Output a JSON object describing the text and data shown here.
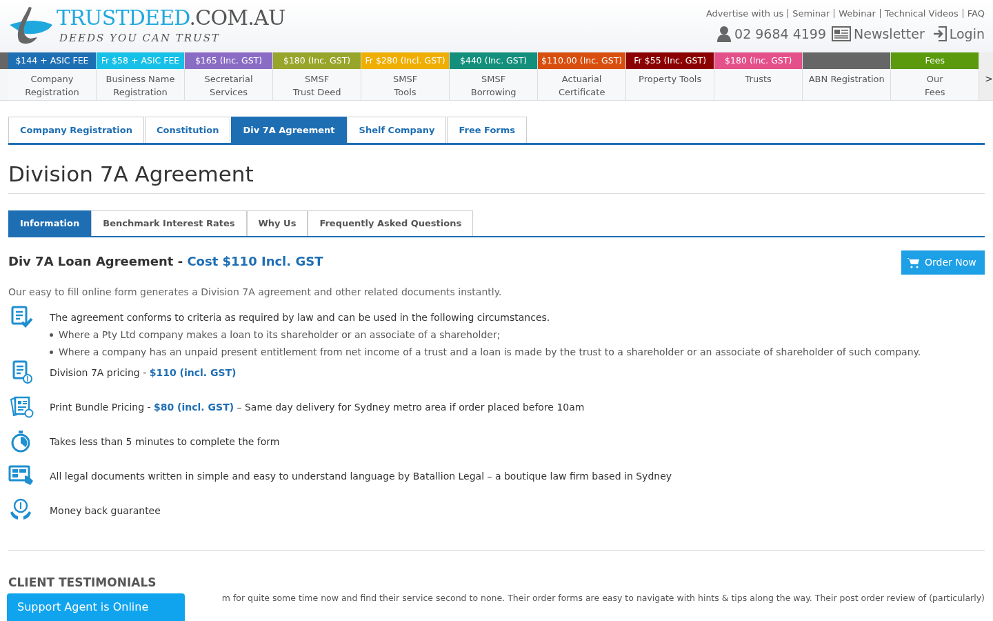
{
  "logo": {
    "name": "TRUSTDEED",
    "domain": ".COM.AU",
    "tagline": "DEEDS YOU CAN TRUST"
  },
  "top_links": [
    "Advertise with us",
    "Seminar",
    "Webinar",
    "Technical Videos",
    "FAQ"
  ],
  "contact": {
    "phone": "02 9684 4199",
    "newsletter": "Newsletter",
    "login": "Login"
  },
  "nav": [
    {
      "price": "$144 + ASIC FEE",
      "label": "Company\nRegistration",
      "color": "#1e6eb4"
    },
    {
      "price": "Fr $58 + ASIC FEE",
      "label": "Business Name\nRegistration",
      "color": "#16c0e6"
    },
    {
      "price": "$165 (Inc. GST)",
      "label": "Secretarial Services",
      "color": "#8a6cc4"
    },
    {
      "price": "$180 (Inc. GST)",
      "label": "SMSF\nTrust Deed",
      "color": "#97a52a"
    },
    {
      "price": "Fr $280 (Incl. GST)",
      "label": "SMSF\nTools",
      "color": "#f0ae00"
    },
    {
      "price": "$440 (Inc. GST)",
      "label": "SMSF\nBorrowing",
      "color": "#138f7c"
    },
    {
      "price": "$110.00 (Inc. GST)",
      "label": "Actuarial\nCertificate",
      "color": "#d84e0e"
    },
    {
      "price": "Fr $55 (Inc. GST)",
      "label": "Property Tools",
      "color": "#8b0000"
    },
    {
      "price": "$180 (Inc. GST)",
      "label": "Trusts",
      "color": "#e4508a"
    },
    {
      "label": "ABN Registration",
      "color": "#666666"
    },
    {
      "price": "Fees",
      "label": "Our\nFees",
      "color": "#5a9a0c"
    }
  ],
  "nav_more": ">",
  "tabs": [
    {
      "label": "Company Registration",
      "selected": false
    },
    {
      "label": "Constitution",
      "selected": false
    },
    {
      "label": "Div 7A Agreement",
      "selected": true
    },
    {
      "label": "Shelf Company",
      "selected": false
    },
    {
      "label": "Free Forms",
      "selected": false
    }
  ],
  "page_title": "Division 7A Agreement",
  "subtabs": [
    {
      "label": "Information",
      "selected": true
    },
    {
      "label": "Benchmark Interest Rates",
      "selected": false
    },
    {
      "label": "Why Us",
      "selected": false
    },
    {
      "label": "Frequently Asked Questions",
      "selected": false
    }
  ],
  "heading": {
    "text": "Div 7A Loan Agreement - ",
    "cost": "Cost $110 Incl. GST"
  },
  "order_button": "Order Now",
  "intro": "Our easy to fill online form generates a Division 7A agreement and other related documents instantly.",
  "features": [
    {
      "kind": "document-check",
      "text": "The agreement conforms to criteria as required by law and can be used in the following circumstances.",
      "bullets": [
        "Where a Pty Ltd company makes a loan to its shareholder or an associate of a shareholder;",
        "Where a company has an unpaid present entitlement from net income of a trust and a loan is made by the trust to a shareholder or an associate of shareholder of such company."
      ]
    },
    {
      "kind": "document-dollar",
      "text": "Division 7A pricing - **$110 (incl. GST)**"
    },
    {
      "kind": "papers-dollar",
      "text": "Print Bundle Pricing - **$80 (incl. GST)** – Same day delivery for Sydney metro area if order placed before 10am"
    },
    {
      "kind": "stopwatch",
      "text": "Takes less than 5 minutes to complete the form"
    },
    {
      "kind": "monitor-hand",
      "text": "All legal documents written in simple and easy to understand language by Batallion Legal – a boutique law firm based in Sydney"
    },
    {
      "kind": "hand-dollar",
      "text": "Money back guarantee"
    }
  ],
  "testimonials": {
    "title": "CLIENT TESTIMONIALS",
    "text": "m for quite some time now and find their service second to none. Their order forms are easy to navigate with hints & tips along the way. Their post order review of (particularly)"
  },
  "chat": "Support Agent is Online"
}
